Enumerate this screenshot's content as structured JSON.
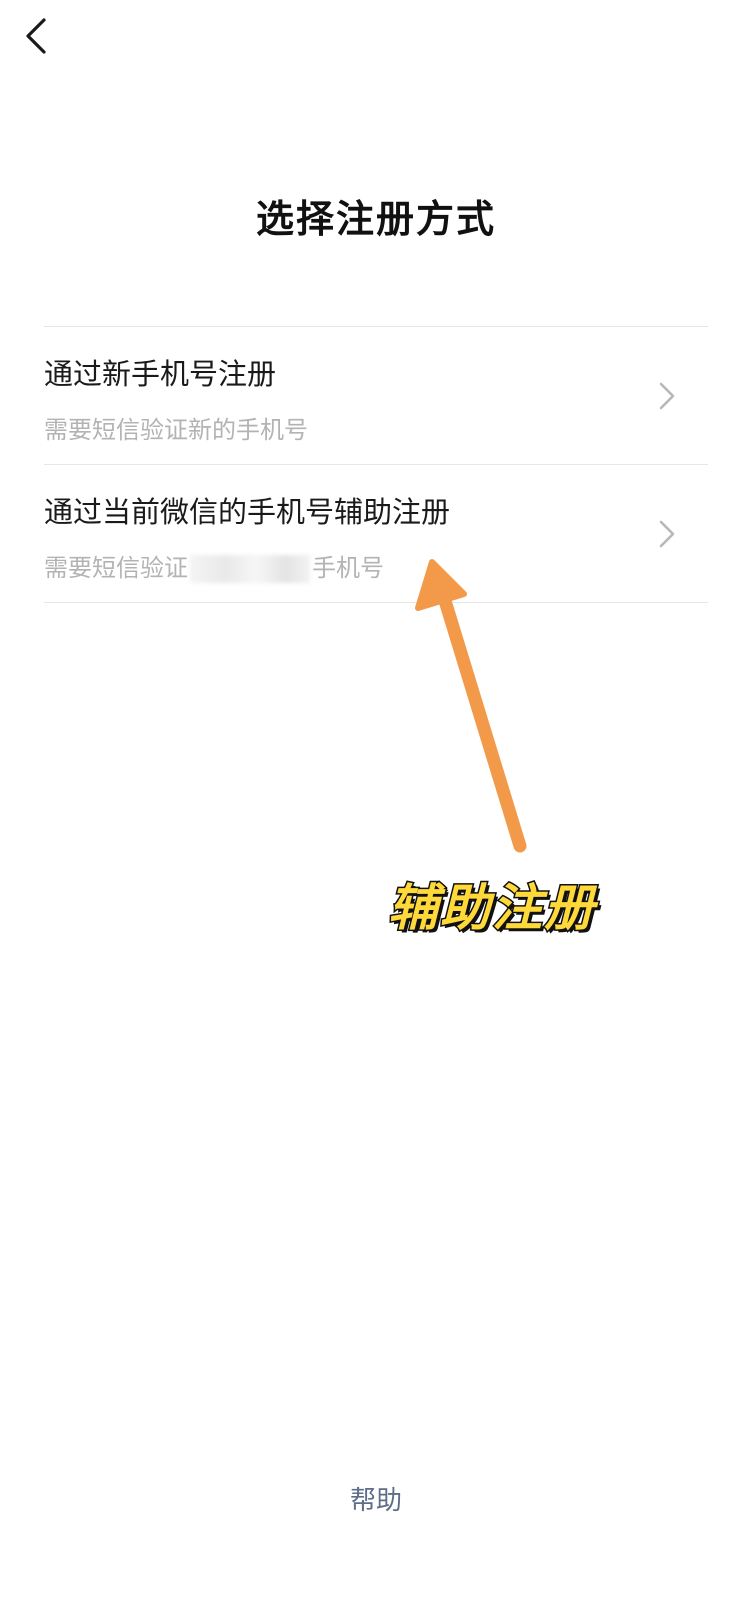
{
  "header": {
    "back_icon": "chevron-left-icon"
  },
  "page": {
    "title": "选择注册方式"
  },
  "options": [
    {
      "title": "通过新手机号注册",
      "desc": "需要短信验证新的手机号",
      "chevron_icon": "chevron-right-icon"
    },
    {
      "title": "通过当前微信的手机号辅助注册",
      "desc_prefix": "需要短信验证",
      "desc_suffix": "手机号",
      "chevron_icon": "chevron-right-icon"
    }
  ],
  "annotation": {
    "label": "辅助注册",
    "arrow_color": "#f39a4a",
    "label_color": "#ffd83a"
  },
  "footer": {
    "help_label": "帮助"
  },
  "colors": {
    "link": "#5e6d88",
    "secondary_text": "#b3b3b3",
    "divider": "#e6e6e6"
  }
}
